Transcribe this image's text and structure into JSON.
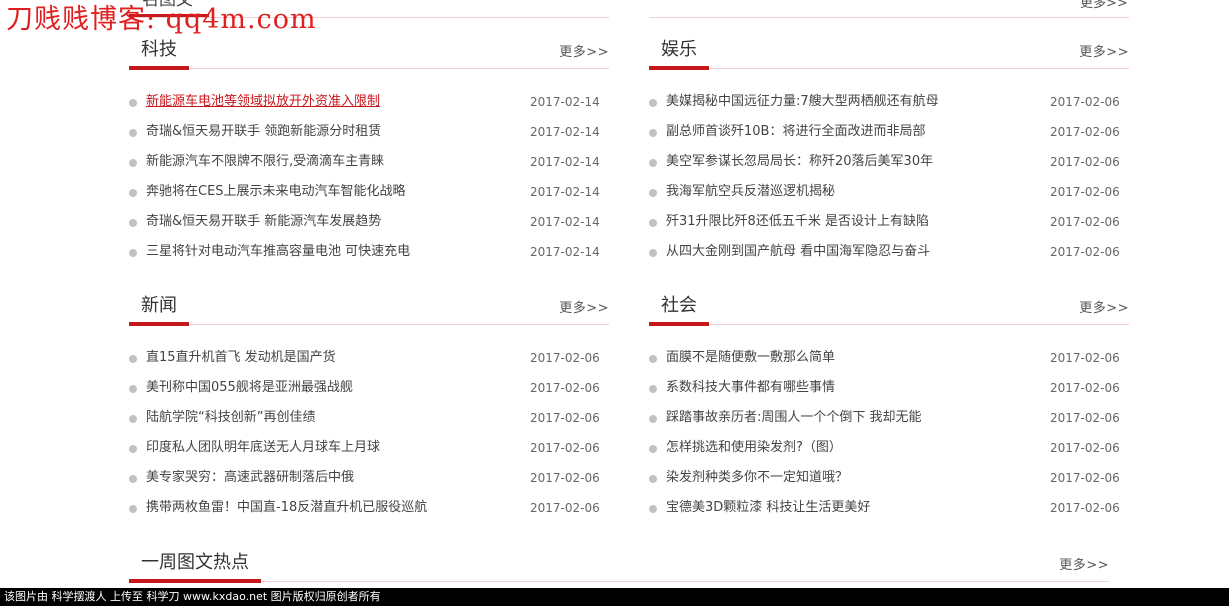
{
  "watermark": "刀贱贱博客: qq4m.com",
  "prev_section": {
    "title": "名图文",
    "more": "更多>>"
  },
  "sections": [
    {
      "title": "科技",
      "more": "更多>>",
      "items": [
        {
          "title": "新能源车电池等领域拟放开外资准入限制",
          "date": "2017-02-14"
        },
        {
          "title": "奇瑞&恒天易开联手 领跑新能源分时租赁",
          "date": "2017-02-14"
        },
        {
          "title": "新能源汽车不限牌不限行,受滴滴车主青睐",
          "date": "2017-02-14"
        },
        {
          "title": "奔驰将在CES上展示未来电动汽车智能化战略",
          "date": "2017-02-14"
        },
        {
          "title": "奇瑞&恒天易开联手 新能源汽车发展趋势",
          "date": "2017-02-14"
        },
        {
          "title": "三星将针对电动汽车推高容量电池 可快速充电",
          "date": "2017-02-14"
        }
      ]
    },
    {
      "title": "娱乐",
      "more": "更多>>",
      "items": [
        {
          "title": "美媒揭秘中国远征力量:7艘大型两栖舰还有航母",
          "date": "2017-02-06"
        },
        {
          "title": "副总师首谈歼10B：将进行全面改进而非局部",
          "date": "2017-02-06"
        },
        {
          "title": "美空军参谋长忽局局长：称歼20落后美军30年",
          "date": "2017-02-06"
        },
        {
          "title": "我海军航空兵反潜巡逻机揭秘",
          "date": "2017-02-06"
        },
        {
          "title": "歼31升限比歼8还低五千米 是否设计上有缺陷",
          "date": "2017-02-06"
        },
        {
          "title": "从四大金刚到国产航母 看中国海军隐忍与奋斗",
          "date": "2017-02-06"
        }
      ]
    },
    {
      "title": "新闻",
      "more": "更多>>",
      "items": [
        {
          "title": "直15直升机首飞 发动机是国产货",
          "date": "2017-02-06"
        },
        {
          "title": "美刊称中国055舰将是亚洲最强战舰",
          "date": "2017-02-06"
        },
        {
          "title": "陆航学院“科技创新”再创佳绩",
          "date": "2017-02-06"
        },
        {
          "title": "印度私人团队明年底送无人月球车上月球",
          "date": "2017-02-06"
        },
        {
          "title": "美专家哭穷：高速武器研制落后中俄",
          "date": "2017-02-06"
        },
        {
          "title": "携带两枚鱼雷！中国直-18反潜直升机已服役巡航",
          "date": "2017-02-06"
        }
      ]
    },
    {
      "title": "社会",
      "more": "更多>>",
      "items": [
        {
          "title": "面膜不是随便敷一敷那么简单",
          "date": "2017-02-06"
        },
        {
          "title": "系数科技大事件都有哪些事情",
          "date": "2017-02-06"
        },
        {
          "title": "踩踏事故亲历者:周围人一个个倒下 我却无能",
          "date": "2017-02-06"
        },
        {
          "title": "怎样挑选和使用染发剂?（图）",
          "date": "2017-02-06"
        },
        {
          "title": "染发剂种类多你不一定知道哦？",
          "date": "2017-02-06"
        },
        {
          "title": "宝德美3D颗粒漆 科技让生活更美好",
          "date": "2017-02-06"
        }
      ]
    }
  ],
  "weekly": {
    "title": "一周图文热点",
    "more": "更多>>"
  },
  "footer": "该图片由 科学摆渡人 上传至 科学刀 www.kxdao.net 图片版权归原创者所有",
  "colors": {
    "accent": "#c8161d",
    "dot": "#c2c2c2"
  }
}
